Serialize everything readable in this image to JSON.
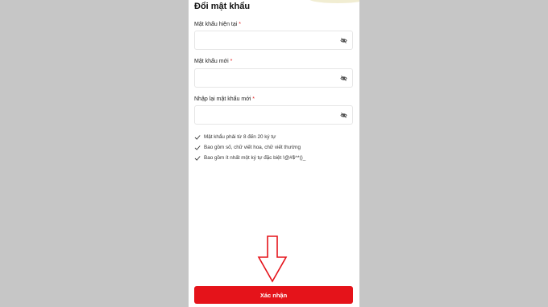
{
  "page": {
    "title": "Đổi mật khẩu"
  },
  "form": {
    "fields": [
      {
        "label": "Mật khẩu hiện tại",
        "required_mark": "*",
        "value": ""
      },
      {
        "label": "Mật khẩu mới",
        "required_mark": "*",
        "value": ""
      },
      {
        "label": "Nhập lại mật khẩu mới",
        "required_mark": "*",
        "value": ""
      }
    ],
    "rules": [
      "Mật khẩu phải từ 8 đến 20 ký tự",
      "Bao gồm số, chữ viết hoa, chữ viết thường",
      "Bao gồm ít nhất một ký tự đặc biệt !@#$^*()_"
    ],
    "submit_label": "Xác nhận"
  },
  "colors": {
    "accent": "#e5131a",
    "required": "#e21f1f",
    "annotation_arrow": "#e5131a",
    "backdrop": "#c6c6c6"
  },
  "icons": {
    "field_toggle": "eye-slash-icon",
    "rule_bullet": "checkmark-icon",
    "annotation": "down-arrow-icon"
  }
}
